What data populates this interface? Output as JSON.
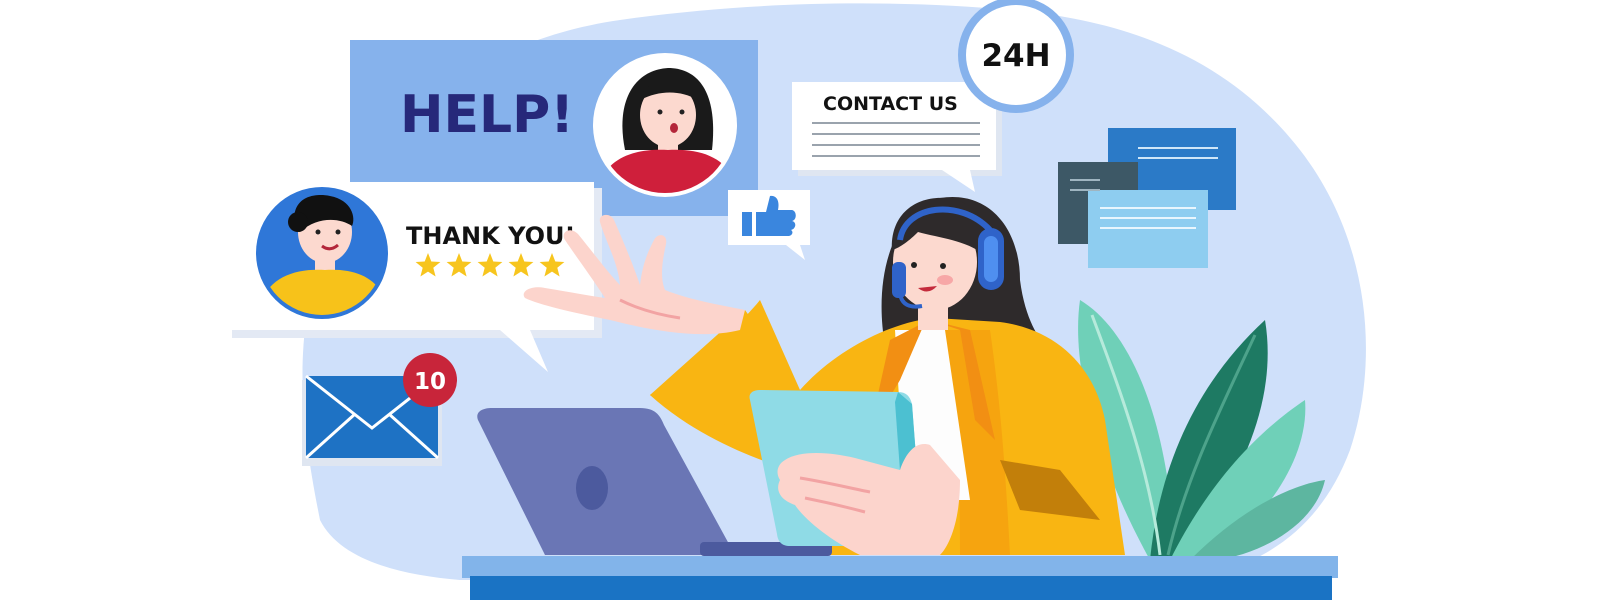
{
  "help_bubble": {
    "text": "HELP!"
  },
  "thank_bubble": {
    "text": "THANK YOU!",
    "rating": 5,
    "rating_max": 5
  },
  "contact_bubble": {
    "text": "CONTACT US"
  },
  "availability_badge": {
    "text": "24H"
  },
  "mail_badge": {
    "count": "10"
  },
  "colors": {
    "background_blob": "#cfe0fa",
    "help_panel": "#86b2ec",
    "help_text": "#26287a",
    "star": "#f7c51e",
    "jacket": "#f9b512",
    "desk": "#1a73c4",
    "laptop": "#6a76b5",
    "leaf_dark": "#1e7a63",
    "leaf_light": "#6fd0b8",
    "badge_red": "#c8253a"
  },
  "icons": [
    "thumbs-up-icon",
    "envelope-icon",
    "headset-icon",
    "chat-document-icon"
  ]
}
